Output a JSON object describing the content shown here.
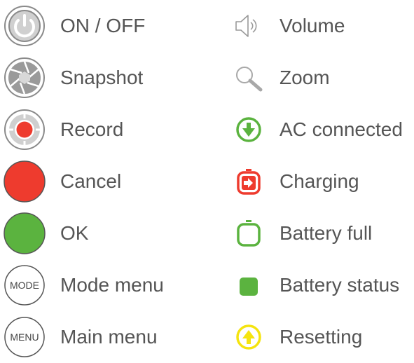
{
  "legend": {
    "left": [
      {
        "icon": "power-icon",
        "label": "ON / OFF"
      },
      {
        "icon": "aperture-icon",
        "label": "Snapshot"
      },
      {
        "icon": "record-icon",
        "label": "Record"
      },
      {
        "icon": "cancel-icon",
        "label": "Cancel"
      },
      {
        "icon": "ok-icon",
        "label": "OK"
      },
      {
        "icon": "mode-button-icon",
        "label": "Mode menu",
        "badge": "MODE"
      },
      {
        "icon": "menu-button-icon",
        "label": "Main menu",
        "badge": "MENU"
      }
    ],
    "right": [
      {
        "icon": "speaker-icon",
        "label": "Volume"
      },
      {
        "icon": "magnifier-icon",
        "label": "Zoom"
      },
      {
        "icon": "ac-connected-icon",
        "label": "AC connected"
      },
      {
        "icon": "charging-battery-icon",
        "label": "Charging"
      },
      {
        "icon": "battery-full-icon",
        "label": "Battery full"
      },
      {
        "icon": "battery-status-icon",
        "label": "Battery status"
      },
      {
        "icon": "resetting-icon",
        "label": "Resetting"
      }
    ]
  },
  "colors": {
    "text": "#555555",
    "outline": "#888888",
    "red": "#ee3b2e",
    "green": "#5bb33f",
    "yellow": "#f5e40f"
  }
}
